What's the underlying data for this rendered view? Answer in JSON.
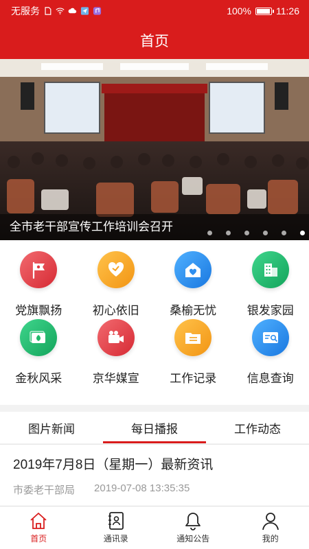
{
  "status_bar": {
    "carrier": "无服务",
    "battery": "100%",
    "battery_level": 1.0,
    "time": "11:26"
  },
  "header": {
    "title": "首页"
  },
  "banner": {
    "caption": "全市老干部宣传工作培训会召开",
    "slide_count": 6,
    "active_slide": 5
  },
  "grid": {
    "items": [
      {
        "label": "党旗飘扬",
        "icon": "party-flag-icon",
        "color": "#e8424a"
      },
      {
        "label": "初心依旧",
        "icon": "heart-icon",
        "color": "#f7a21b"
      },
      {
        "label": "桑榆无忧",
        "icon": "home-heart-icon",
        "color": "#2e8ff0"
      },
      {
        "label": "银发家园",
        "icon": "building-icon",
        "color": "#22b86b"
      },
      {
        "label": "金秋风采",
        "icon": "photo-leaf-icon",
        "color": "#22b86b"
      },
      {
        "label": "京华媒宣",
        "icon": "video-camera-icon",
        "color": "#e8424a"
      },
      {
        "label": "工作记录",
        "icon": "folder-icon",
        "color": "#f7a21b"
      },
      {
        "label": "信息查询",
        "icon": "id-search-icon",
        "color": "#2e8ff0"
      }
    ]
  },
  "tabs": {
    "items": [
      "图片新闻",
      "每日播报",
      "工作动态"
    ],
    "active": 1
  },
  "news": {
    "title": "2019年7月8日（星期一）最新资讯",
    "source": "市委老干部局",
    "timestamp": "2019-07-08 13:35:35"
  },
  "bottom_nav": {
    "items": [
      {
        "label": "首页",
        "icon": "home-icon"
      },
      {
        "label": "通讯录",
        "icon": "contacts-icon"
      },
      {
        "label": "通知公告",
        "icon": "bell-icon"
      },
      {
        "label": "我的",
        "icon": "user-icon"
      }
    ],
    "active": 0
  },
  "colors": {
    "brand": "#d91c1c"
  }
}
